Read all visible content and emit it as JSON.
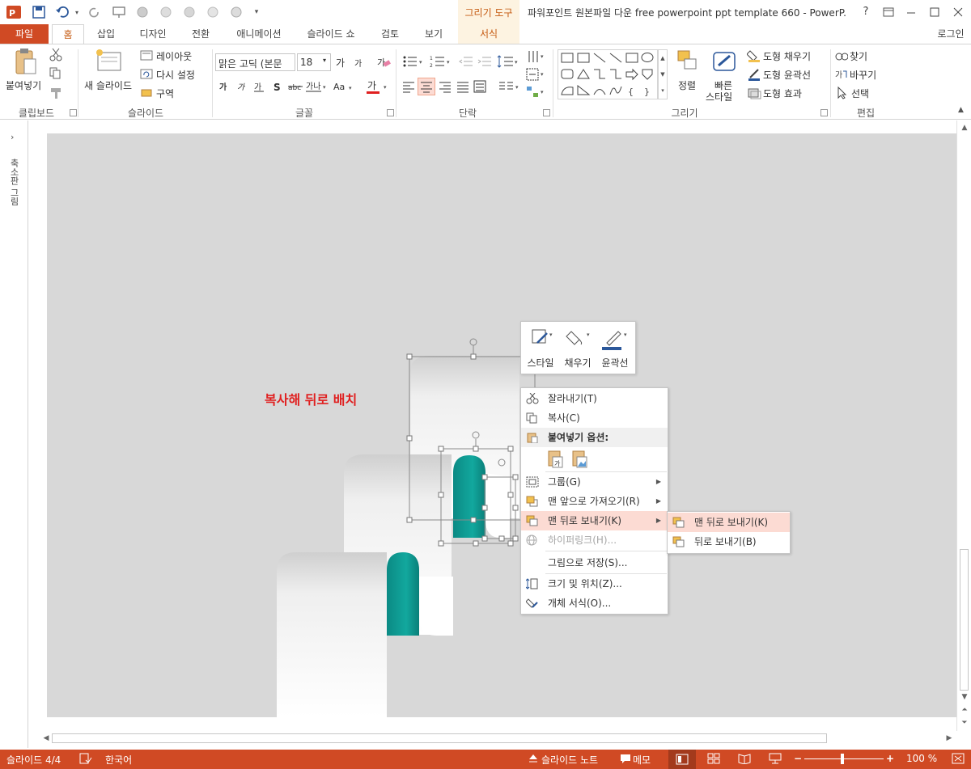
{
  "window": {
    "title": "파워포인트 원본파일 다운 free powerpoint ppt template 660 - PowerP...",
    "context_tab_header": "그리기 도구",
    "help": "?",
    "login": "로그인"
  },
  "tabs": [
    {
      "label": "파일"
    },
    {
      "label": "홈"
    },
    {
      "label": "삽입"
    },
    {
      "label": "디자인"
    },
    {
      "label": "전환"
    },
    {
      "label": "애니메이션"
    },
    {
      "label": "슬라이드 쇼"
    },
    {
      "label": "검토"
    },
    {
      "label": "보기"
    },
    {
      "label": "서식"
    }
  ],
  "ribbon": {
    "clipboard": {
      "label": "클립보드",
      "paste": "붙여넣기"
    },
    "slides": {
      "label": "슬라이드",
      "new_slide": "새 슬라이드",
      "layout": "레이아웃",
      "reset": "다시 설정",
      "section": "구역"
    },
    "font": {
      "label": "글꼴",
      "font_name": "맑은 고딕 (본문",
      "font_size": "18"
    },
    "paragraph": {
      "label": "단락"
    },
    "drawing": {
      "label": "그리기",
      "arrange": "정렬",
      "quick_styles_1": "빠른",
      "quick_styles_2": "스타일",
      "shape_fill": "도형 채우기",
      "shape_outline": "도형 윤곽선",
      "shape_effects": "도형 효과"
    },
    "editing": {
      "label": "편집",
      "find": "찾기",
      "replace": "바꾸기",
      "select": "선택"
    }
  },
  "thumbnails_pane": {
    "label": "축소판 그림"
  },
  "slide": {
    "annotation": "복사해 뒤로 배치"
  },
  "mini_toolbar": [
    {
      "label": "스타일"
    },
    {
      "label": "채우기"
    },
    {
      "label": "윤곽선"
    }
  ],
  "context_menu": {
    "cut": "잘라내기(T)",
    "copy": "복사(C)",
    "paste_options": "붙여넣기 옵션:",
    "group": "그룹(G)",
    "bring_to_front": "맨 앞으로 가져오기(R)",
    "send_to_back": "맨 뒤로 보내기(K)",
    "hyperlink": "하이퍼링크(H)...",
    "save_as_picture": "그림으로 저장(S)...",
    "size_position": "크기 및 위치(Z)...",
    "format_object": "개체 서식(O)..."
  },
  "submenu": {
    "send_to_back": "맨 뒤로 보내기(K)",
    "send_backward": "뒤로 보내기(B)"
  },
  "status": {
    "slide": "슬라이드 4/4",
    "language": "한국어",
    "notes": "슬라이드 노트",
    "comments": "메모",
    "zoom": "100 %"
  },
  "colors": {
    "accent": "#d04a24",
    "teal": "#0e9a92",
    "annotation_red": "#e02020",
    "canvas": "#d8d8d8"
  }
}
